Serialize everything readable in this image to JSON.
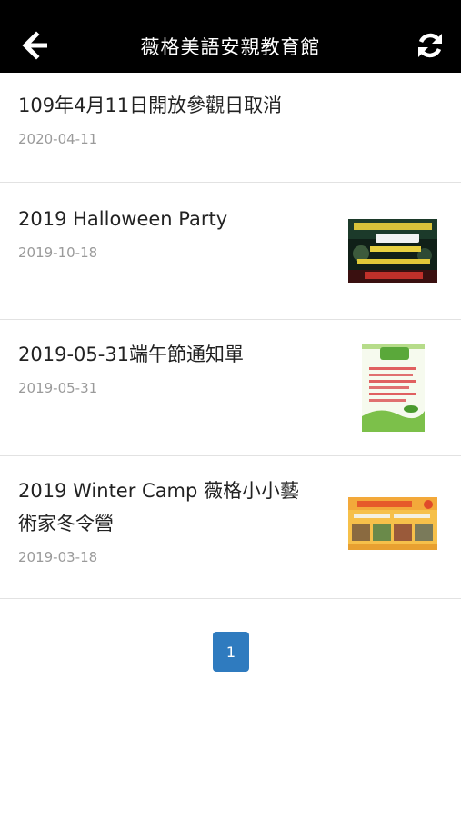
{
  "header": {
    "title": "薇格美語安親教育館",
    "back_icon": "arrow-left-icon",
    "refresh_icon": "refresh-icon"
  },
  "posts": [
    {
      "title_lines": [
        "109年4月11日開放參觀日取消"
      ],
      "date": "2020-04-11",
      "thumbnail": ""
    },
    {
      "title_lines": [
        "2019 Halloween Party"
      ],
      "date": "2019-10-18",
      "thumbnail": "halloween-poster-image"
    },
    {
      "title_lines": [
        "2019-05-31端午節通知單"
      ],
      "date": "2019-05-31",
      "thumbnail": "dragon-boat-festival-notice-image"
    },
    {
      "title_lines": [
        "2019 Winter Camp 薇格小小藝",
        "術家冬令營"
      ],
      "date": "2019-03-18",
      "thumbnail": "winter-camp-flyer-image"
    }
  ],
  "pagination": {
    "current_page": "1"
  },
  "colors": {
    "header_bg": "#000000",
    "pager_bg": "#2f7bbf",
    "date_text": "#9a9a9a"
  }
}
